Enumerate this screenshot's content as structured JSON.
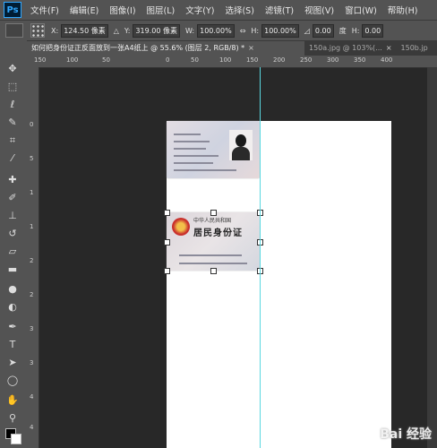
{
  "app": {
    "logo": "Ps"
  },
  "menu": [
    "文件(F)",
    "编辑(E)",
    "图像(I)",
    "图层(L)",
    "文字(Y)",
    "选择(S)",
    "滤镜(T)",
    "视图(V)",
    "窗口(W)",
    "帮助(H)"
  ],
  "options": {
    "x_label": "X:",
    "x_value": "124.50 像素",
    "y_label": "Y:",
    "y_value": "319.00 像素",
    "w_label": "W:",
    "w_value": "100.00%",
    "h_label": "H:",
    "h_value": "100.00%",
    "angle_value": "0.00",
    "angle_unit": "度",
    "hskew_label": "H:",
    "hskew_value": "0.00"
  },
  "tabs": [
    {
      "label": "如何把身份证正反面放到一张A4纸上 @ 55.6% (图层 2, RGB/8) *",
      "close": "×"
    },
    {
      "label": "150a.jpg @ 103%(...",
      "close": "×"
    },
    {
      "label": "150b.jp"
    }
  ],
  "ruler_h_labels": [
    "150",
    "100",
    "50",
    "0",
    "50",
    "100",
    "150",
    "200",
    "250",
    "300",
    "350",
    "400"
  ],
  "ruler_v_labels": [
    "0",
    "5",
    "1",
    "1",
    "2",
    "2",
    "3",
    "3",
    "4",
    "4",
    "5"
  ],
  "id_back": {
    "title": "中华人民共和国",
    "main": "居民身份证"
  },
  "watermark": "Bai 经验",
  "icons": [
    "move-icon",
    "marquee-icon",
    "lasso-icon",
    "quick-select-icon",
    "crop-icon",
    "eyedropper-icon",
    "healing-icon",
    "brush-icon",
    "stamp-icon",
    "history-brush-icon",
    "eraser-icon",
    "gradient-icon",
    "blur-icon",
    "dodge-icon",
    "pen-icon",
    "type-icon",
    "path-select-icon",
    "shape-icon",
    "hand-icon",
    "zoom-icon"
  ]
}
